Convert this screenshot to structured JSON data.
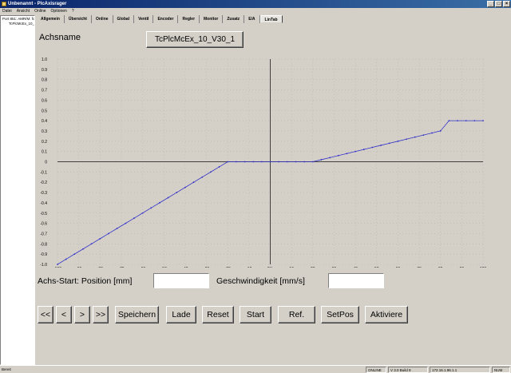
{
  "window": {
    "title": "Unbenannt - PlcAxisrager"
  },
  "menu": [
    "Datei",
    "Ansicht",
    "Online",
    "Optionen",
    "?"
  ],
  "tree": {
    "root": "Port 851: AMR/M: fc",
    "child": "TcPlcMcEx_10_V"
  },
  "tabs": [
    "Allgemein",
    "Übersicht",
    "Online",
    "Global",
    "Ventil",
    "Encoder",
    "Regler",
    "Monitor",
    "Zusatz",
    "E/A",
    "LinTab"
  ],
  "active_tab": 10,
  "axis": {
    "label": "Achsname",
    "name": "TcPlcMcEx_10_V30_1"
  },
  "fields": {
    "start_label": "Achs-Start: Position [mm]",
    "speed_label": "Geschwindigkeit [mm/s]",
    "position_value": "",
    "speed_value": ""
  },
  "buttons": {
    "first": "<<",
    "prev": "<",
    "next": ">",
    "last": ">>",
    "save": "Speichern",
    "load": "Lade",
    "reset": "Reset",
    "start": "Start",
    "ref": "Ref.",
    "setpos": "SetPos",
    "activate": "Aktiviere"
  },
  "status": {
    "ready": "Bereit",
    "online": "ONLINE",
    "version": "V 3.0 Build 9",
    "ip": "172.16.1.96.1.1",
    "num": "NUM"
  },
  "chart_data": {
    "type": "line",
    "xlim": [
      -100,
      100
    ],
    "ylim": [
      -1.0,
      1.0
    ],
    "x_ticks": [
      "-100",
      "-90",
      "-80",
      "-70",
      "-60",
      "-50",
      "-40",
      "-30",
      "-20",
      "-10",
      "0%",
      "10",
      "20",
      "30",
      "40",
      "50",
      "60",
      "70",
      "80",
      "90",
      "100"
    ],
    "y_ticks": [
      "1.0",
      "0.9",
      "0.8",
      "0.7",
      "0.6",
      "0.5",
      "0.4",
      "0.3",
      "0.2",
      "0.1",
      "0",
      "-0.1",
      "-0.2",
      "-0.3",
      "-0.4",
      "-0.5",
      "-0.6",
      "-0.7",
      "-0.8",
      "-0.9",
      "-1.0"
    ],
    "grid": true,
    "colors": {
      "line": "#3232c8",
      "grid": "#b4b4b4",
      "axis": "#404040"
    },
    "series": [
      {
        "x": [
          -100,
          -96,
          -92,
          -88,
          -84,
          -80,
          -76,
          -72,
          -68,
          -64,
          -60,
          -56,
          -52,
          -48,
          -44,
          -40,
          -36,
          -32,
          -28,
          -24,
          -20,
          -16,
          -12,
          -8,
          -4,
          0,
          4,
          8,
          12,
          16,
          20,
          24,
          28,
          32,
          36,
          40,
          44,
          48,
          52,
          56,
          60,
          64,
          68,
          72,
          76,
          80,
          84,
          88,
          92,
          96,
          100
        ],
        "y": [
          -1.0,
          -0.95,
          -0.9,
          -0.85,
          -0.8,
          -0.75,
          -0.7,
          -0.65,
          -0.6,
          -0.55,
          -0.5,
          -0.45,
          -0.4,
          -0.35,
          -0.3,
          -0.25,
          -0.2,
          -0.15,
          -0.1,
          -0.05,
          0,
          0,
          0,
          0,
          0,
          0,
          0,
          0,
          0,
          0,
          0,
          0.02,
          0.04,
          0.06,
          0.08,
          0.1,
          0.12,
          0.14,
          0.16,
          0.18,
          0.2,
          0.22,
          0.24,
          0.26,
          0.28,
          0.3,
          0.4,
          0.4,
          0.4,
          0.4,
          0.4
        ]
      }
    ]
  }
}
